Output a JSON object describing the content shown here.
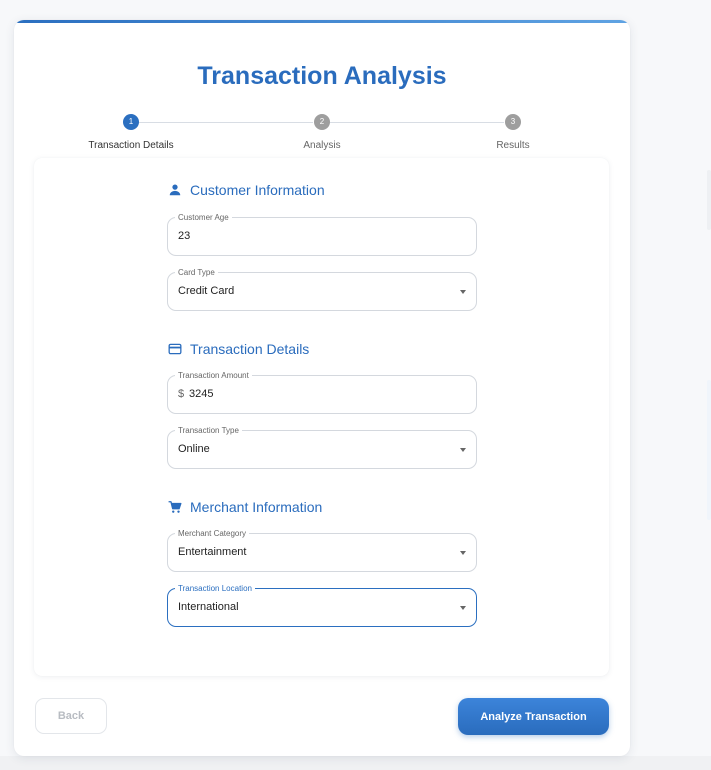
{
  "page": {
    "title": "Transaction Analysis"
  },
  "stepper": {
    "steps": [
      {
        "number": "1",
        "label": "Transaction Details",
        "active": true
      },
      {
        "number": "2",
        "label": "Analysis",
        "active": false
      },
      {
        "number": "3",
        "label": "Results",
        "active": false
      }
    ]
  },
  "sections": {
    "customer": {
      "heading": "Customer Information",
      "icon": "person-icon",
      "age": {
        "label": "Customer Age",
        "value": "23"
      },
      "card_type": {
        "label": "Card Type",
        "value": "Credit Card"
      }
    },
    "transaction": {
      "heading": "Transaction Details",
      "icon": "credit-card-icon",
      "amount": {
        "label": "Transaction Amount",
        "prefix": "$",
        "value": "3245"
      },
      "type": {
        "label": "Transaction Type",
        "value": "Online"
      }
    },
    "merchant": {
      "heading": "Merchant Information",
      "icon": "shopping-cart-icon",
      "category": {
        "label": "Merchant Category",
        "value": "Entertainment"
      },
      "location": {
        "label": "Transaction Location",
        "value": "International"
      }
    }
  },
  "actions": {
    "back_label": "Back",
    "analyze_label": "Analyze Transaction"
  },
  "colors": {
    "primary": "#2a6cbd",
    "step_inactive": "#9e9e9e",
    "border": "#d4d8de"
  }
}
